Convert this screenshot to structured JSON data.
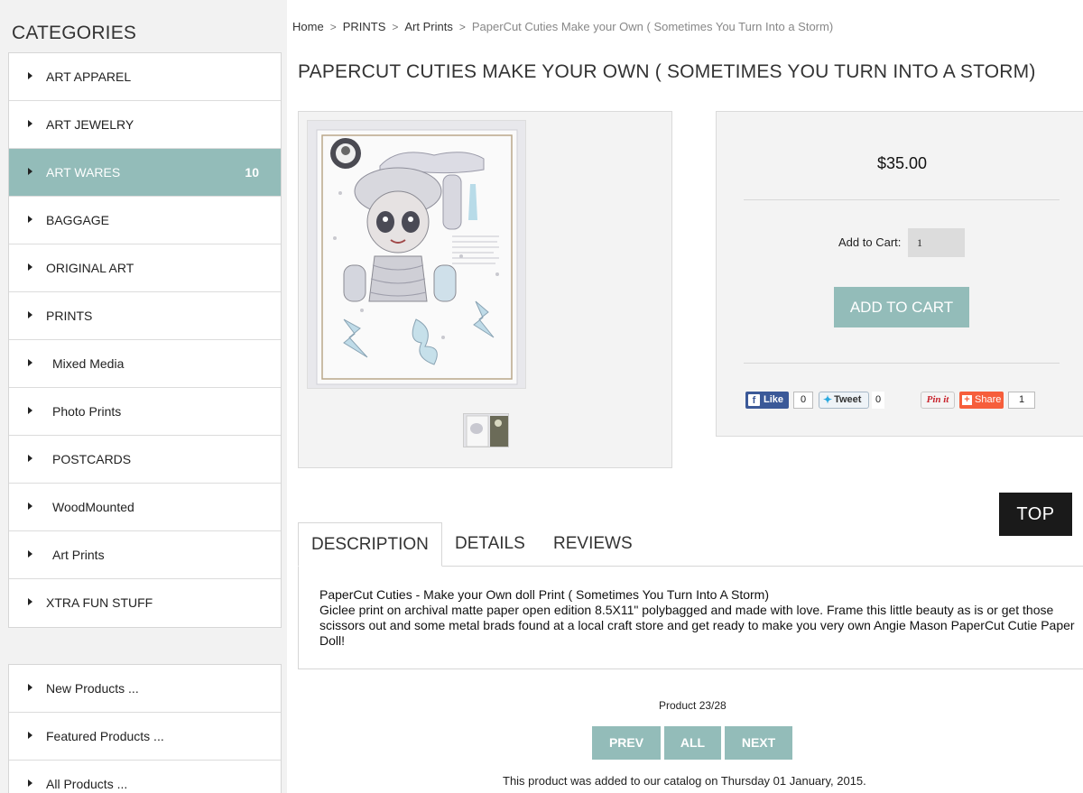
{
  "sidebar": {
    "title": "CATEGORIES",
    "items": [
      {
        "label": "ART APPAREL"
      },
      {
        "label": "ART JEWELRY"
      },
      {
        "label": "ART WARES",
        "count": "10"
      },
      {
        "label": "BAGGAGE"
      },
      {
        "label": "ORIGINAL ART"
      },
      {
        "label": "PRINTS"
      },
      {
        "label": "Mixed Media"
      },
      {
        "label": "Photo Prints"
      },
      {
        "label": "POSTCARDS"
      },
      {
        "label": "WoodMounted"
      },
      {
        "label": "Art Prints"
      },
      {
        "label": "XTRA FUN STUFF"
      }
    ],
    "extra_items": [
      {
        "label": "New Products ..."
      },
      {
        "label": "Featured Products ..."
      },
      {
        "label": "All Products ..."
      }
    ]
  },
  "breadcrumb": {
    "items": [
      "Home",
      "PRINTS",
      "Art Prints"
    ],
    "current": "PaperCut Cuties Make your Own ( Sometimes You Turn Into a Storm)"
  },
  "product": {
    "title": "PAPERCUT CUTIES MAKE YOUR OWN ( SOMETIMES YOU TURN INTO A STORM)",
    "price": "$35.00",
    "add_to_cart_label": "Add to Cart:",
    "quantity": "1",
    "add_to_cart_button": "ADD TO CART"
  },
  "social": {
    "like_label": "Like",
    "like_count": "0",
    "tweet_label": "Tweet",
    "tweet_count": "0",
    "pin_label": "Pin it",
    "share_label": "Share",
    "share_count": "1"
  },
  "top_button": "TOP",
  "tabs": [
    "DESCRIPTION",
    "DETAILS",
    "REVIEWS"
  ],
  "description": {
    "line1": "PaperCut Cuties - Make your Own doll Print ( Sometimes You Turn Into A Storm)",
    "line2": "Giclee print on archival matte paper open edition 8.5X11\" polybagged and made with love. Frame this little beauty as is or get those scissors out and some metal brads found at a local craft store and get ready to make you very own Angie Mason PaperCut Cutie Paper Doll!"
  },
  "pagination": {
    "counter": "Product 23/28",
    "prev": "PREV",
    "all": "ALL",
    "next": "NEXT"
  },
  "added_note": "This product was added to our catalog on Thursday 01 January, 2015.",
  "colors": {
    "accent": "#93bcb9",
    "sidebar_bg": "#f2f2f2",
    "panel_bg": "#f3f3f3",
    "top_button_bg": "#1a1a1a"
  }
}
